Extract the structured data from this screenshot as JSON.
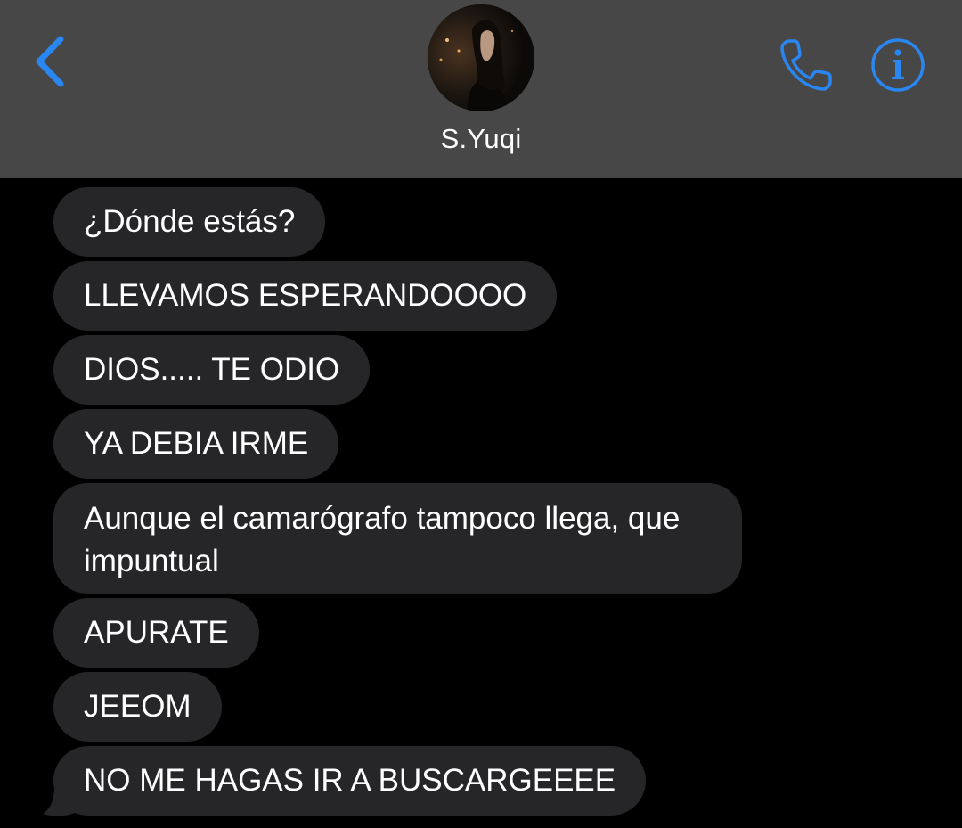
{
  "contact": {
    "name": "S.Yuqi"
  },
  "colors": {
    "accent": "#2a86f0",
    "header_bg": "#474747",
    "bubble_bg": "#262628",
    "background": "#000000"
  },
  "icons": {
    "back": "chevron-left-icon",
    "call": "phone-icon",
    "info": "info-icon"
  },
  "messages": [
    {
      "text": "¿Dónde estás?"
    },
    {
      "text": "LLEVAMOS ESPERANDOOOO"
    },
    {
      "text": "DIOS..... TE ODIO"
    },
    {
      "text": "YA DEBIA IRME"
    },
    {
      "text": "Aunque el camarógrafo tampoco llega, que impuntual"
    },
    {
      "text": "APURATE"
    },
    {
      "text": "JEEOM"
    },
    {
      "text": "NO ME HAGAS IR A BUSCARGEEEE"
    }
  ]
}
